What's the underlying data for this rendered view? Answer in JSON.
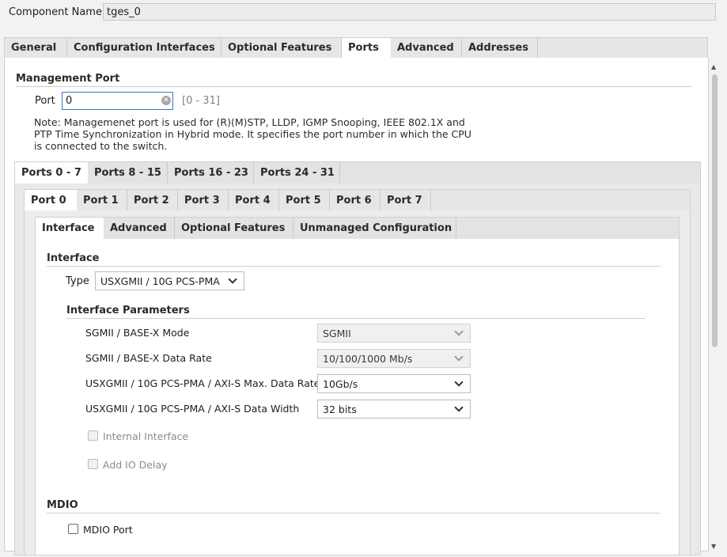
{
  "component": {
    "label": "Component Name",
    "value": "tges_0"
  },
  "main_tabs": [
    "General",
    "Configuration Interfaces",
    "Optional Features",
    "Ports",
    "Advanced",
    "Addresses"
  ],
  "management": {
    "title": "Management Port",
    "port_label": "Port",
    "port_value": "0",
    "range_hint": "[0 - 31]",
    "note": "Note: Managemenet port is used for (R)(M)STP, LLDP, IGMP Snooping, IEEE 802.1X and PTP Time Synchronization in Hybrid mode. It specifies the port number in which the CPU is connected to the switch."
  },
  "port_groups": [
    "Ports 0 - 7",
    "Ports 8 - 15",
    "Ports 16 - 23",
    "Ports 24 - 31"
  ],
  "ports": [
    "Port 0",
    "Port 1",
    "Port 2",
    "Port 3",
    "Port 4",
    "Port 5",
    "Port 6",
    "Port 7"
  ],
  "sub_tabs": [
    "Interface",
    "Advanced",
    "Optional Features",
    "Unmanaged Configuration"
  ],
  "interface": {
    "title": "Interface",
    "type_label": "Type",
    "type_value": "USXGMII / 10G PCS-PMA",
    "params_title": "Interface Parameters",
    "params": [
      {
        "label": "SGMII / BASE-X Mode",
        "value": "SGMII",
        "enabled": false
      },
      {
        "label": "SGMII / BASE-X Data Rate",
        "value": "10/100/1000 Mb/s",
        "enabled": false
      },
      {
        "label": "USXGMII / 10G PCS-PMA / AXI-S Max. Data Rate",
        "value": "10Gb/s",
        "enabled": true
      },
      {
        "label": "USXGMII / 10G PCS-PMA / AXI-S Data Width",
        "value": "32 bits",
        "enabled": true
      }
    ],
    "internal_interface": "Internal Interface",
    "add_io_delay": "Add IO Delay"
  },
  "mdio": {
    "title": "MDIO",
    "port_label": "MDIO Port"
  },
  "colors": {
    "accent": "#3b76c8",
    "panel": "#ffffff",
    "tab_bg": "#e6e6e6"
  }
}
